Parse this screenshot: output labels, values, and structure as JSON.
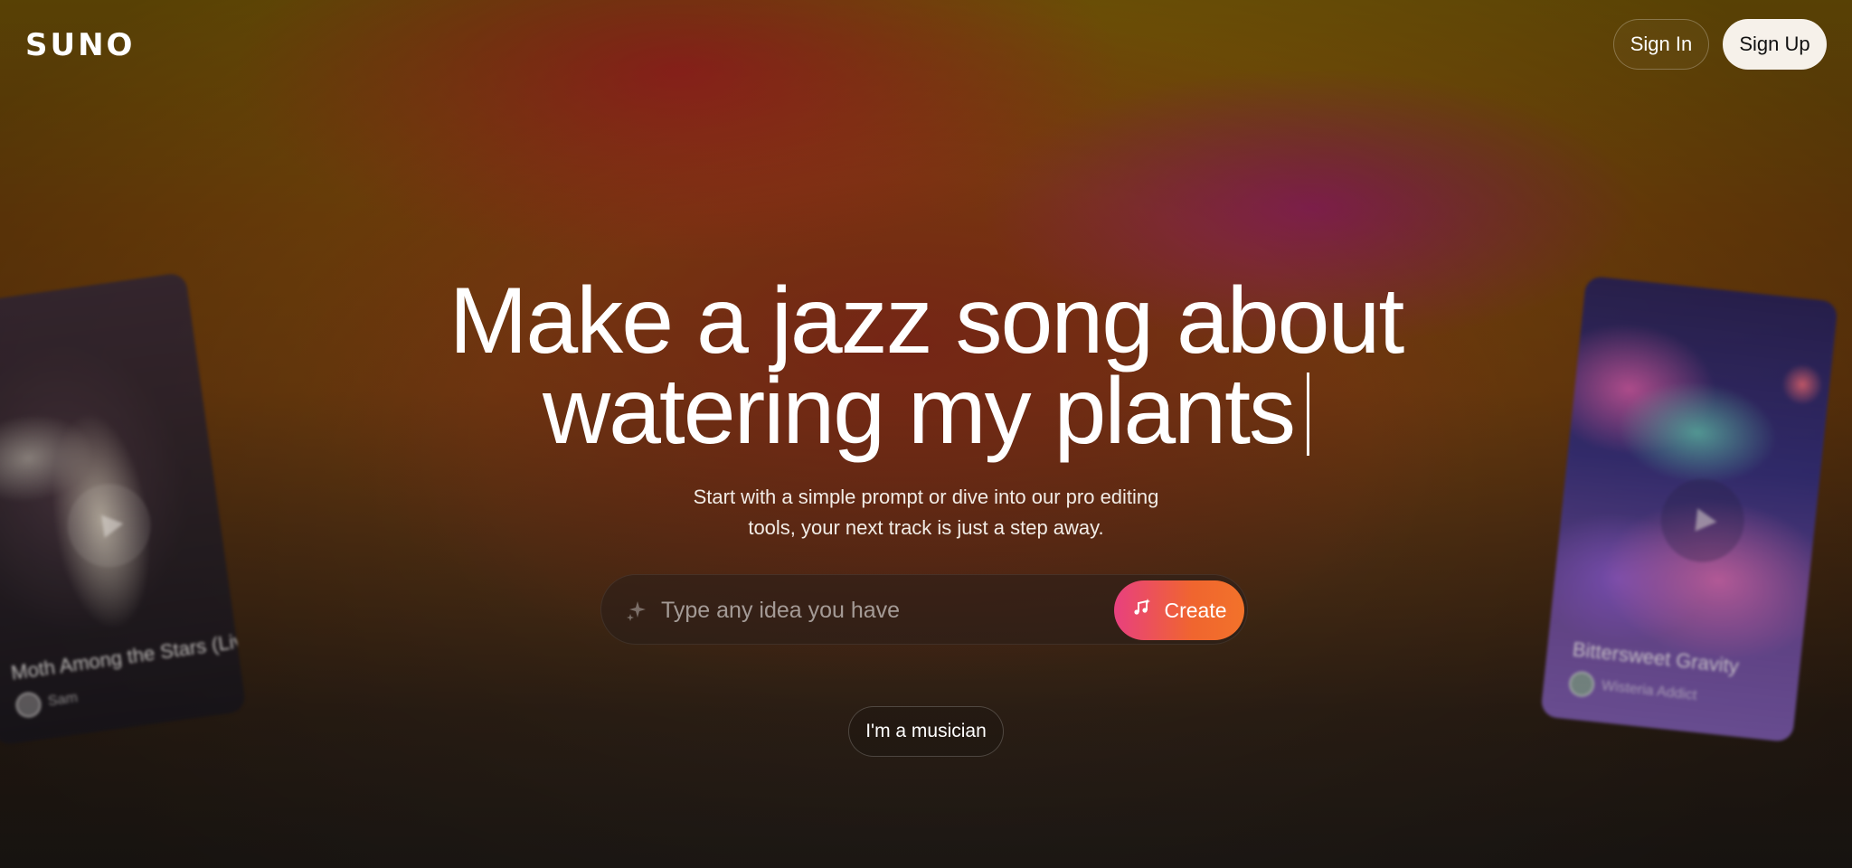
{
  "brand": {
    "logo": "SUNO"
  },
  "header": {
    "sign_in_label": "Sign In",
    "sign_up_label": "Sign Up"
  },
  "hero": {
    "headline_line1": "Make a jazz song about",
    "headline_line2": "watering my plants",
    "subtitle_line1": "Start with a simple prompt or dive into our pro editing",
    "subtitle_line2": "tools, your next track is just a step away."
  },
  "prompt": {
    "placeholder": "Type any idea you have",
    "value": "",
    "create_label": "Create",
    "sparkle_icon": "sparkle-icon",
    "create_icon": "music-sparkle-icon"
  },
  "musician_button_label": "I'm a musician",
  "cards": [
    {
      "title": "Moth Among the Stars (Live)",
      "artist": "Sam",
      "icon": "play-icon"
    },
    {
      "title": "Bittersweet Gravity",
      "artist": "Wisteria Addict",
      "icon": "play-icon"
    }
  ],
  "colors": {
    "create_gradient_start": "#e8407f",
    "create_gradient_end": "#f2722a",
    "sign_up_bg": "#f6f1ea"
  }
}
